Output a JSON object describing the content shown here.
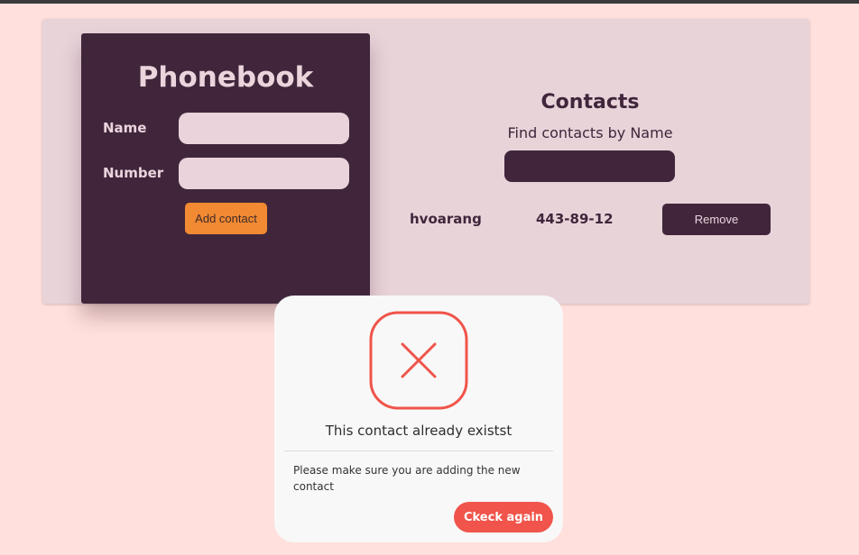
{
  "phonebook": {
    "title": "Phonebook",
    "name_label": "Name",
    "name_value": "",
    "number_label": "Number",
    "number_value": "",
    "add_button_label": "Add contact"
  },
  "contacts": {
    "title": "Contacts",
    "filter_label": "Find contacts by Name",
    "filter_value": "",
    "items": [
      {
        "name": "hvoarang",
        "number": "443-89-12",
        "remove_label": "Remove"
      }
    ]
  },
  "modal": {
    "icon": "close-x-icon",
    "title": "This contact already existst",
    "body": "Please make sure you are adding the new contact",
    "confirm_label": "Ckeck again"
  },
  "colors": {
    "page_background": "#ffe0dc",
    "card_background": "#e8d3d9",
    "panel_dark": "#41263b",
    "accent_orange": "#f28a33",
    "error_red": "#f0544a"
  }
}
